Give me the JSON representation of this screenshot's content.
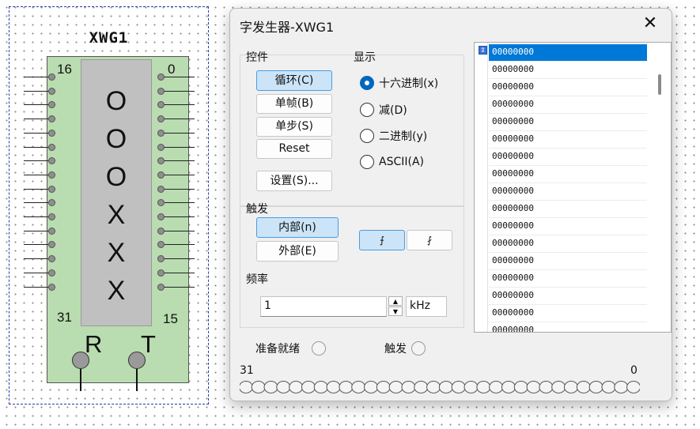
{
  "component": {
    "title": "XWG1",
    "pin_top_left": "16",
    "pin_top_right": "0",
    "pin_bottom_left": "31",
    "pin_bottom_right": "15",
    "digits": [
      "O",
      "O",
      "O",
      "X",
      "X",
      "X"
    ],
    "reset_label": "R",
    "trigger_label": "T"
  },
  "dialog": {
    "title": "字发生器-XWG1",
    "close_icon": "close-icon",
    "controls": {
      "label": "控件",
      "cycle": "循环(C)",
      "burst": "单帧(B)",
      "step": "单步(S)",
      "reset": "Reset",
      "settings": "设置(S)..."
    },
    "display": {
      "label": "显示",
      "options": [
        {
          "label": "十六进制(x)",
          "checked": true
        },
        {
          "label": "减(D)",
          "checked": false
        },
        {
          "label": "二进制(y)",
          "checked": false
        },
        {
          "label": "ASCII(A)",
          "checked": false
        }
      ]
    },
    "trigger": {
      "label": "触发",
      "internal": "内部(n)",
      "external": "外部(E)",
      "rising_icon": "rising-edge-icon",
      "falling_icon": "falling-edge-icon"
    },
    "frequency": {
      "label": "频率",
      "value": "1",
      "unit": "kHz"
    },
    "status": {
      "ready": "准备就绪",
      "trigger": "触发"
    },
    "bits": {
      "high": "31",
      "low": "0",
      "count": 32
    },
    "memory": {
      "rows": [
        "00000000",
        "00000000",
        "00000000",
        "00000000",
        "00000000",
        "00000000",
        "00000000",
        "00000000",
        "00000000",
        "00000000",
        "00000000",
        "00000000",
        "00000000",
        "00000000",
        "00000000",
        "00000000",
        "00000000"
      ],
      "selected_index": 0
    }
  }
}
